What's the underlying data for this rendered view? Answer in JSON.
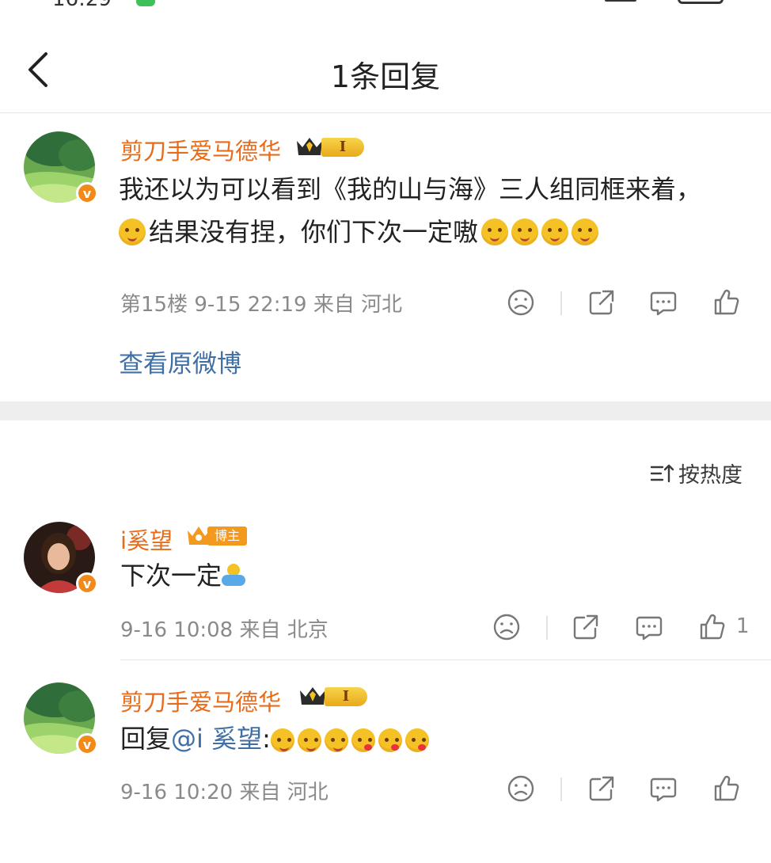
{
  "status_bar": {
    "time": "16:29"
  },
  "header": {
    "title": "1条回复"
  },
  "main_comment": {
    "username": "剪刀手爱马德华",
    "level": "I",
    "text_line1": "我还以为可以看到《我的山与海》三人组同框来着，",
    "text_line2": "结果没有捏，你们下次一定嗷",
    "meta": "第15楼  9-15 22:19  来自 河北",
    "view_original": "查看原微博"
  },
  "sort": {
    "label": "按热度"
  },
  "replies": [
    {
      "username": "i奚望",
      "badge": "博主",
      "text": "下次一定",
      "meta": "9-16 10:08  来自 北京",
      "likes": "1"
    },
    {
      "username": "剪刀手爱马德华",
      "level": "I",
      "text_prefix": "回复",
      "mention": "@i 奚望",
      "text_suffix": ":",
      "meta": "9-16 10:20  来自 河北"
    }
  ],
  "colors": {
    "username": "#e86b1a",
    "link": "#3f6fa5",
    "meta": "#8a8a8a",
    "badge": "#f39a1e"
  }
}
